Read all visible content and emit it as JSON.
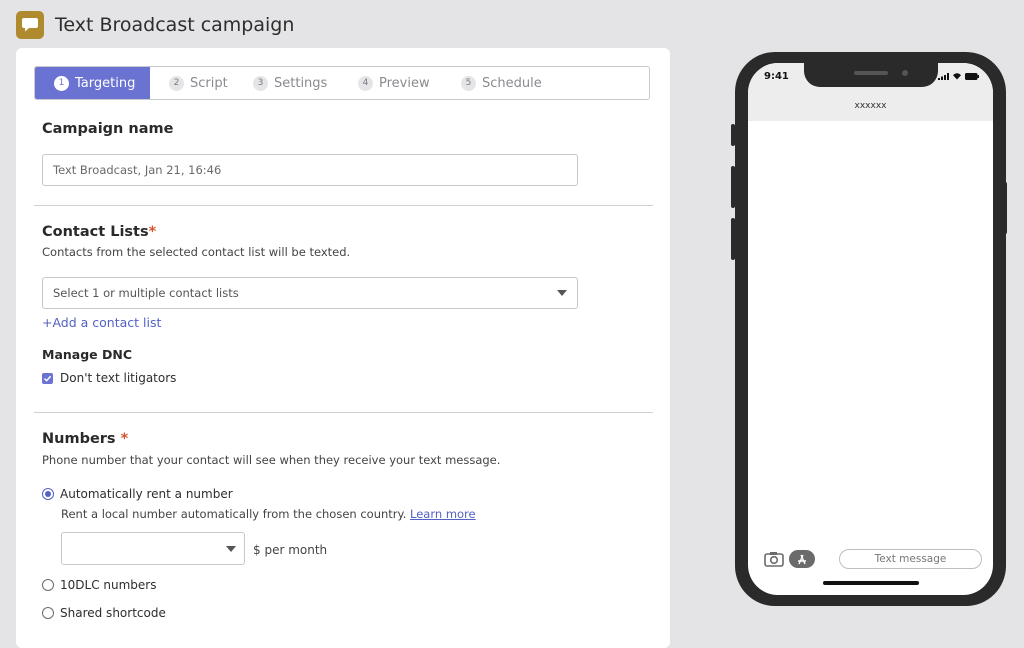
{
  "header": {
    "title": "Text Broadcast campaign",
    "icon": "chat-bubble-icon",
    "icon_color": "#b08a2e"
  },
  "stepper": {
    "steps": [
      {
        "num": "1",
        "label": "Targeting"
      },
      {
        "num": "2",
        "label": "Script"
      },
      {
        "num": "3",
        "label": "Settings"
      },
      {
        "num": "4",
        "label": "Preview"
      },
      {
        "num": "5",
        "label": "Schedule"
      }
    ],
    "active_color": "#6a73d1"
  },
  "campaign_name": {
    "title": "Campaign name",
    "value": "Text Broadcast, Jan 21, 16:46"
  },
  "contact_lists": {
    "title": "Contact Lists",
    "required_mark": "*",
    "help": "Contacts from the selected contact list will be texted.",
    "placeholder": "Select 1 or multiple contact lists",
    "add_link": "+Add a contact list"
  },
  "dnc": {
    "title": "Manage DNC",
    "checkbox_label": "Don't text litigators"
  },
  "numbers": {
    "title": "Numbers",
    "required_mark": "*",
    "help": "Phone number that your contact will see when they receive your text message.",
    "option_auto": "Automatically rent a number",
    "auto_help": "Rent a local number automatically from the chosen country.",
    "learn_more": "Learn more",
    "price_suffix": "$ per month",
    "option_10dlc": "10DLC numbers",
    "option_shortcode": "Shared shortcode"
  },
  "phone": {
    "time": "9:41",
    "contact": "xxxxxx",
    "message_placeholder": "Text message",
    "icons": [
      "signal-icon",
      "wifi-icon",
      "battery-icon",
      "camera-icon",
      "app-store-icon"
    ]
  }
}
